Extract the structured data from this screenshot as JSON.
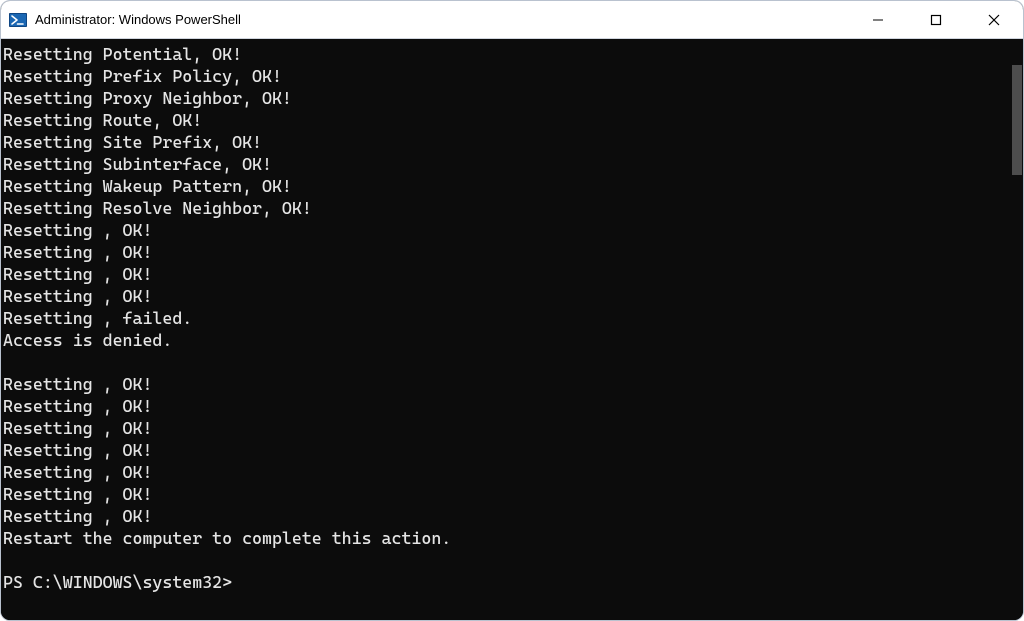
{
  "window": {
    "title": "Administrator: Windows PowerShell"
  },
  "output": {
    "lines": [
      "Resetting Potential, OK!",
      "Resetting Prefix Policy, OK!",
      "Resetting Proxy Neighbor, OK!",
      "Resetting Route, OK!",
      "Resetting Site Prefix, OK!",
      "Resetting Subinterface, OK!",
      "Resetting Wakeup Pattern, OK!",
      "Resetting Resolve Neighbor, OK!",
      "Resetting , OK!",
      "Resetting , OK!",
      "Resetting , OK!",
      "Resetting , OK!",
      "Resetting , failed.",
      "Access is denied.",
      "",
      "Resetting , OK!",
      "Resetting , OK!",
      "Resetting , OK!",
      "Resetting , OK!",
      "Resetting , OK!",
      "Resetting , OK!",
      "Resetting , OK!",
      "Restart the computer to complete this action.",
      ""
    ]
  },
  "prompt": {
    "text": "PS C:\\WINDOWS\\system32>"
  }
}
